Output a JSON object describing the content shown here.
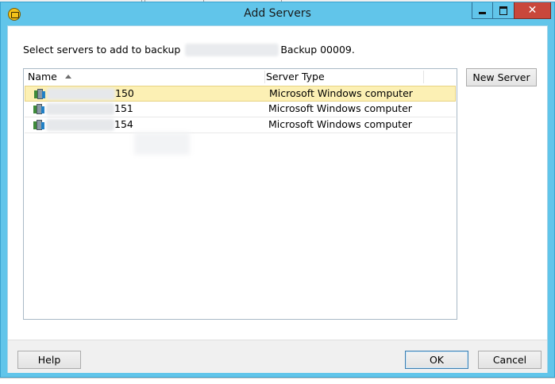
{
  "window": {
    "title": "Add Servers",
    "controls": {
      "minimize_icon": "minimize-icon",
      "maximize_icon": "maximize-icon",
      "close_glyph": "✕"
    }
  },
  "prompt": {
    "prefix": "Select servers to add to backup",
    "suffix": "Backup 00009."
  },
  "list": {
    "columns": [
      {
        "label": "Name",
        "sorted": "ascending"
      },
      {
        "label": "Server Type"
      }
    ],
    "rows": [
      {
        "name_suffix": "150",
        "type": "Microsoft Windows computer",
        "selected": true,
        "icon": "windows-server-icon"
      },
      {
        "name_suffix": "151",
        "type": "Microsoft Windows computer",
        "selected": false,
        "icon": "windows-server-icon"
      },
      {
        "name_suffix": "154",
        "type": "Microsoft Windows computer",
        "selected": false,
        "icon": "windows-server-icon"
      }
    ]
  },
  "buttons": {
    "new_server": "New Server",
    "help": "Help",
    "ok": "OK",
    "cancel": "Cancel"
  },
  "colors": {
    "titlebar": "#61c5ea",
    "close_button": "#c9473b",
    "selected_row": "#fcf0b4"
  }
}
